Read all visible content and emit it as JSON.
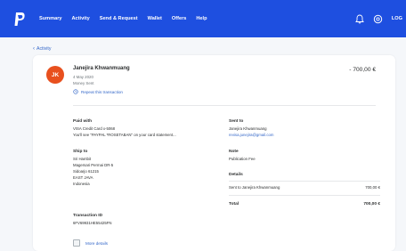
{
  "nav": {
    "items": [
      "Summary",
      "Activity",
      "Send & Request",
      "Wallet",
      "Offers",
      "Help"
    ],
    "user_label": "LOG"
  },
  "back": {
    "label": "Activity"
  },
  "transaction": {
    "avatar_initials": "JK",
    "name": "Janejira Khwanmuang",
    "date": "4 May 2020",
    "type": "Money Sent",
    "repeat_label": "Repeat this transaction",
    "amount": "- 700,00 €"
  },
  "paid_with": {
    "heading": "Paid with",
    "method": "VISA Credit Card x-5068",
    "note": "You'll see \"PAYPAL *ROSETABAN\" on your card statement..."
  },
  "ship_to": {
    "heading": "Ship to",
    "lines": [
      "Sri Hambit",
      "Magersari Permai DR-5",
      "Sidoarjo 61215",
      "EAST JAVA",
      "Indonesia"
    ]
  },
  "transaction_id": {
    "heading": "Transaction ID",
    "value": "6FV69931HE55425FN"
  },
  "sent_to": {
    "heading": "Sent to",
    "name": "Janejira Khwanmuang",
    "email": "revisa.junejira@gmail.com"
  },
  "note": {
    "heading": "Note",
    "text": "Publication Fee"
  },
  "details": {
    "heading": "Details",
    "row_label": "Sent to Janejira Khwanmuang",
    "row_value": "700,00 €",
    "total_label": "Total",
    "total_value": "700,00 €"
  },
  "more_details": {
    "label": "More details"
  },
  "colors": {
    "brand": "#1e4fe0",
    "link": "#3568c9",
    "avatar": "#e8501e"
  },
  "icons": [
    "paypal-logo-icon",
    "bell-icon",
    "settings-icon",
    "chevron-left-icon",
    "repeat-icon"
  ]
}
